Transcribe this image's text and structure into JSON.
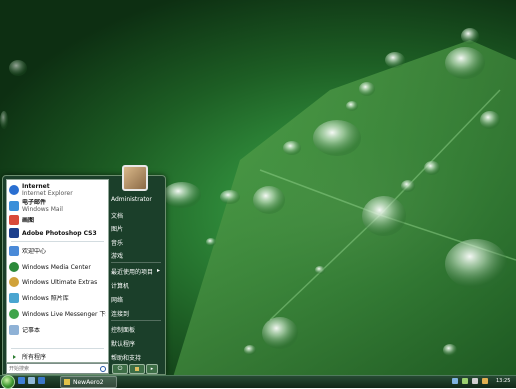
{
  "start_menu": {
    "pinned": [
      {
        "title": "Internet",
        "subtitle": "Internet Explorer",
        "icon": "ie-icon",
        "color": "#2a6fd1"
      },
      {
        "title": "电子邮件",
        "subtitle": "Windows Mail",
        "icon": "mail-icon",
        "color": "#3a8fd9"
      },
      {
        "title": "画图",
        "subtitle": "",
        "icon": "paint-icon",
        "color": "#d94a3a"
      },
      {
        "title": "Adobe Photoshop CS3",
        "subtitle": "",
        "icon": "photoshop-icon",
        "color": "#1c3f8c"
      }
    ],
    "recent": [
      {
        "label": "欢迎中心",
        "icon": "welcome-icon",
        "color": "#4a8ad8"
      },
      {
        "label": "Windows Media Center",
        "icon": "media-center-icon",
        "color": "#2c8a3a"
      },
      {
        "label": "Windows Ultimate Extras",
        "icon": "extras-icon",
        "color": "#d0a23a"
      },
      {
        "label": "Windows 照片库",
        "icon": "photo-gallery-icon",
        "color": "#4aa5d0"
      },
      {
        "label": "Windows Live Messenger 下载",
        "icon": "messenger-icon",
        "color": "#3fa44b"
      },
      {
        "label": "记事本",
        "icon": "notepad-icon",
        "color": "#8fb2d6"
      }
    ],
    "all_programs": "所有程序",
    "search_placeholder": "开始搜索",
    "right_items": [
      "Administrator",
      "文档",
      "图片",
      "音乐",
      "游戏",
      "最近使用的项目",
      "计算机",
      "网络",
      "连接到",
      "控制面板",
      "默认程序",
      "帮助和支持"
    ]
  },
  "taskbar": {
    "task_button": "NewAero2",
    "clock": "13:25"
  }
}
